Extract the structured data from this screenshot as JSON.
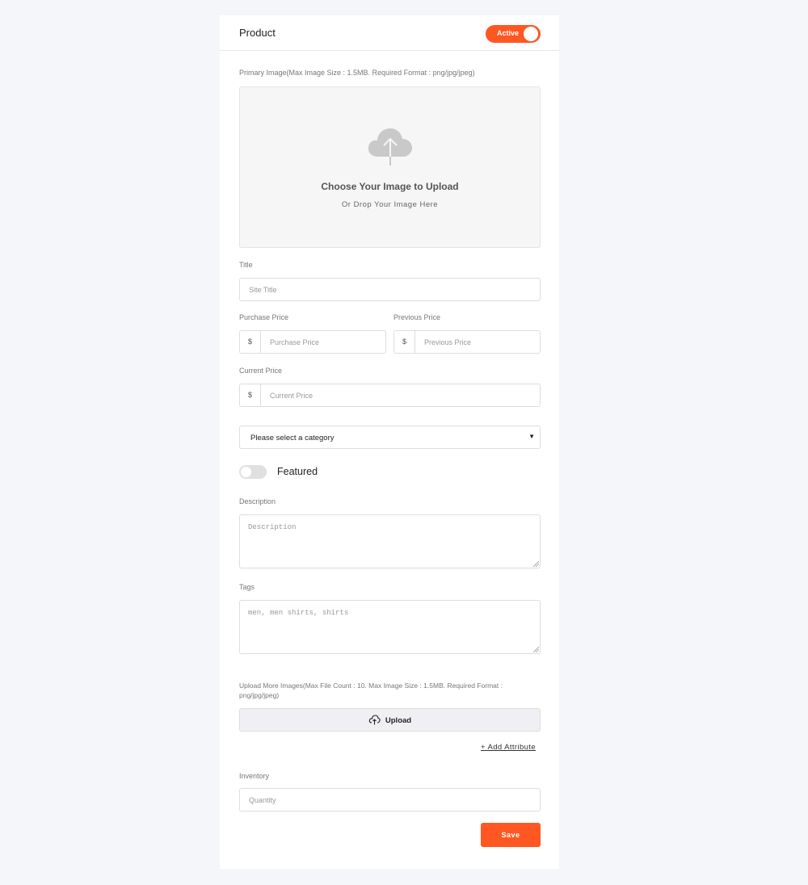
{
  "header": {
    "title": "Product",
    "status_toggle_label": "Active"
  },
  "primary_image": {
    "label": "Primary Image(Max Image Size : 1.5MB. Required Format : png/jpg/jpeg)",
    "drop_title": "Choose Your Image to Upload",
    "drop_subtitle": "Or Drop Your Image Here",
    "icon": "cloud-upload-icon"
  },
  "title_field": {
    "label": "Title",
    "placeholder": "Site Title"
  },
  "purchase_price": {
    "label": "Purchase Price",
    "prefix": "$",
    "placeholder": "Purchase Price"
  },
  "previous_price": {
    "label": "Previous Price",
    "prefix": "$",
    "placeholder": "Previous Price"
  },
  "current_price": {
    "label": "Current Price",
    "prefix": "$",
    "placeholder": "Current Price"
  },
  "category": {
    "selected": "Please select a category"
  },
  "featured": {
    "label": "Featured"
  },
  "description": {
    "label": "Description",
    "placeholder": "Description"
  },
  "tags": {
    "label": "Tags",
    "placeholder": "men, men shirts, shirts"
  },
  "more_images": {
    "label": "Upload More Images(Max File Count : 10. Max Image Size : 1.5MB. Required Format : png/jpg/jpeg)",
    "button_label": "Upload"
  },
  "add_attribute": "+ Add Attribute",
  "inventory": {
    "label": "Inventory",
    "placeholder": "Quantity"
  },
  "save_label": "Save",
  "colors": {
    "accent": "#ff5722",
    "page_bg": "#f5f6fa"
  }
}
